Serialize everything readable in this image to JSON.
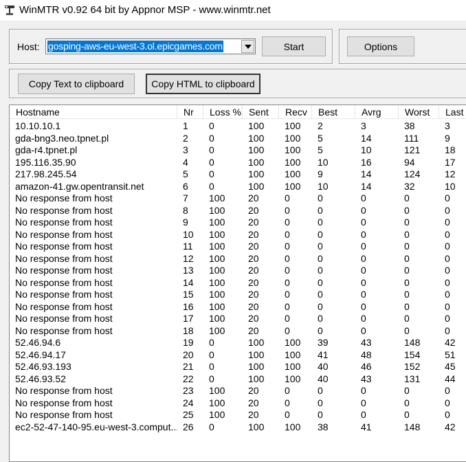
{
  "window": {
    "title": "WinMTR v0.92 64 bit by Appnor MSP - www.winmtr.net",
    "icon": "winmtr-app-icon"
  },
  "host": {
    "label": "Host:",
    "value": "gosping-aws-eu-west-3.ol.epicgames.com"
  },
  "buttons": {
    "start": "Start",
    "options": "Options",
    "copy_text": "Copy Text to clipboard",
    "copy_html": "Copy HTML to clipboard"
  },
  "table": {
    "columns": [
      "Hostname",
      "Nr",
      "Loss %",
      "Sent",
      "Recv",
      "Best",
      "Avrg",
      "Worst",
      "Last"
    ],
    "rows": [
      [
        "10.10.10.1",
        "1",
        "0",
        "100",
        "100",
        "2",
        "3",
        "38",
        "3"
      ],
      [
        "gda-bng3.neo.tpnet.pl",
        "2",
        "0",
        "100",
        "100",
        "5",
        "14",
        "111",
        "9"
      ],
      [
        "gda-r4.tpnet.pl",
        "3",
        "0",
        "100",
        "100",
        "5",
        "10",
        "121",
        "18"
      ],
      [
        "195.116.35.90",
        "4",
        "0",
        "100",
        "100",
        "10",
        "16",
        "94",
        "17"
      ],
      [
        "217.98.245.54",
        "5",
        "0",
        "100",
        "100",
        "9",
        "14",
        "124",
        "12"
      ],
      [
        "amazon-41.gw.opentransit.net",
        "6",
        "0",
        "100",
        "100",
        "10",
        "14",
        "32",
        "10"
      ],
      [
        "No response from host",
        "7",
        "100",
        "20",
        "0",
        "0",
        "0",
        "0",
        "0"
      ],
      [
        "No response from host",
        "8",
        "100",
        "20",
        "0",
        "0",
        "0",
        "0",
        "0"
      ],
      [
        "No response from host",
        "9",
        "100",
        "20",
        "0",
        "0",
        "0",
        "0",
        "0"
      ],
      [
        "No response from host",
        "10",
        "100",
        "20",
        "0",
        "0",
        "0",
        "0",
        "0"
      ],
      [
        "No response from host",
        "11",
        "100",
        "20",
        "0",
        "0",
        "0",
        "0",
        "0"
      ],
      [
        "No response from host",
        "12",
        "100",
        "20",
        "0",
        "0",
        "0",
        "0",
        "0"
      ],
      [
        "No response from host",
        "13",
        "100",
        "20",
        "0",
        "0",
        "0",
        "0",
        "0"
      ],
      [
        "No response from host",
        "14",
        "100",
        "20",
        "0",
        "0",
        "0",
        "0",
        "0"
      ],
      [
        "No response from host",
        "15",
        "100",
        "20",
        "0",
        "0",
        "0",
        "0",
        "0"
      ],
      [
        "No response from host",
        "16",
        "100",
        "20",
        "0",
        "0",
        "0",
        "0",
        "0"
      ],
      [
        "No response from host",
        "17",
        "100",
        "20",
        "0",
        "0",
        "0",
        "0",
        "0"
      ],
      [
        "No response from host",
        "18",
        "100",
        "20",
        "0",
        "0",
        "0",
        "0",
        "0"
      ],
      [
        "52.46.94.6",
        "19",
        "0",
        "100",
        "100",
        "39",
        "43",
        "148",
        "42"
      ],
      [
        "52.46.94.17",
        "20",
        "0",
        "100",
        "100",
        "41",
        "48",
        "154",
        "51"
      ],
      [
        "52.46.93.193",
        "21",
        "0",
        "100",
        "100",
        "40",
        "46",
        "152",
        "45"
      ],
      [
        "52.46.93.52",
        "22",
        "0",
        "100",
        "100",
        "40",
        "43",
        "131",
        "44"
      ],
      [
        "No response from host",
        "23",
        "100",
        "20",
        "0",
        "0",
        "0",
        "0",
        "0"
      ],
      [
        "No response from host",
        "24",
        "100",
        "20",
        "0",
        "0",
        "0",
        "0",
        "0"
      ],
      [
        "No response from host",
        "25",
        "100",
        "20",
        "0",
        "0",
        "0",
        "0",
        "0"
      ],
      [
        "ec2-52-47-140-95.eu-west-3.comput...",
        "26",
        "0",
        "100",
        "100",
        "38",
        "41",
        "148",
        "42"
      ]
    ]
  },
  "colors": {
    "selection": "#0078d7",
    "background": "#f0f0f0"
  }
}
